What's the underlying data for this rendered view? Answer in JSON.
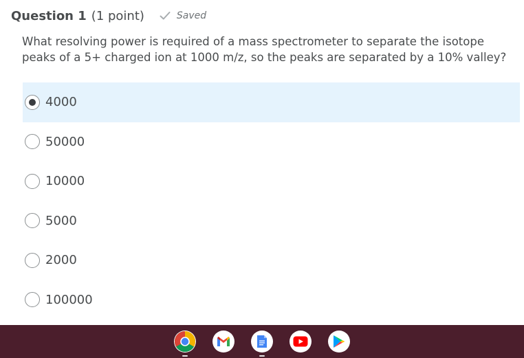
{
  "question": {
    "title": "Question 1",
    "points": "(1 point)",
    "saved_label": "Saved",
    "text": "What resolving power is required of a mass spectrometer to separate the isotope peaks of a 5+ charged ion at 1000 m/z, so the peaks are separated by a 10% valley?"
  },
  "options": [
    {
      "label": "4000",
      "selected": true
    },
    {
      "label": "50000",
      "selected": false
    },
    {
      "label": "10000",
      "selected": false
    },
    {
      "label": "5000",
      "selected": false
    },
    {
      "label": "2000",
      "selected": false
    },
    {
      "label": "100000",
      "selected": false
    }
  ],
  "colors": {
    "selected_background": "#e5f3fd",
    "shelf_background": "#4b1e2c",
    "text": "#494c4e"
  },
  "shelf": {
    "apps": [
      {
        "name": "chrome-icon",
        "running": true
      },
      {
        "name": "gmail-icon",
        "running": false
      },
      {
        "name": "google-docs-icon",
        "running": true
      },
      {
        "name": "youtube-icon",
        "running": false
      },
      {
        "name": "play-store-icon",
        "running": false
      }
    ]
  }
}
